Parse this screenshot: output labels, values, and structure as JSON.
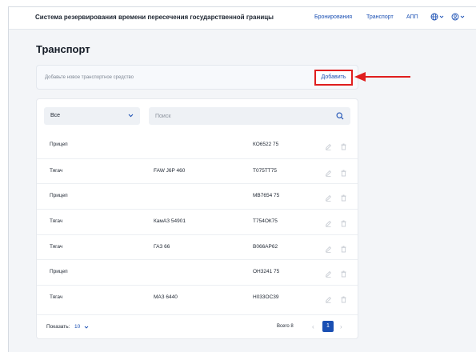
{
  "header": {
    "title": "Система резервирования времени пересечения государственной границы",
    "nav": [
      "Бронирования",
      "Транспорт",
      "АПП"
    ]
  },
  "page": {
    "title": "Транспорт",
    "add_hint": "Добавьте новое транспортное средство",
    "add_label": "Добавить"
  },
  "filters": {
    "type_value": "Все",
    "search_placeholder": "Поиск"
  },
  "rows": [
    {
      "type": "Прицеп",
      "model": "",
      "number": "КО6522 75"
    },
    {
      "type": "Тягач",
      "model": "FAW J6P 460",
      "number": "Т075ТТ75"
    },
    {
      "type": "Прицеп",
      "model": "",
      "number": "МВ7654 75"
    },
    {
      "type": "Тягач",
      "model": "КамАЗ 54901",
      "number": "Т754ОК75"
    },
    {
      "type": "Тягач",
      "model": "ГАЗ 66",
      "number": "В066АР62"
    },
    {
      "type": "Прицеп",
      "model": "",
      "number": "ОН3241 75"
    },
    {
      "type": "Тягач",
      "model": "МАЗ 6440",
      "number": "Н033ОС39"
    }
  ],
  "footer": {
    "show_label": "Показать:",
    "show_count": "10",
    "total": "Всего 8",
    "current_page": "1"
  },
  "colors": {
    "accent": "#1a4fb3",
    "annotation": "#e01e1e"
  }
}
